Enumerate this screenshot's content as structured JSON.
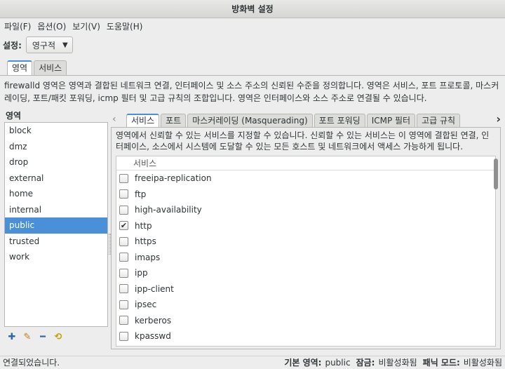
{
  "window": {
    "title": "방화벽 설정"
  },
  "menu": [
    "파일(F)",
    "옵션(O)",
    "보기(V)",
    "도움말(H)"
  ],
  "configuration": {
    "label": "설정:",
    "value": "영구적"
  },
  "top_tabs": [
    "영역",
    "서비스"
  ],
  "zone_description": "firewalld 영역은 영역과 결합된 네트워크 연결, 인터페이스 및 소스 주소의 신뢰된 수준을 정의합니다. 영역은 서비스, 포트 프로토콜, 마스커레이딩, 포트/패킷 포워딩, icmp 필터 및 고급 규칙의 조합입니다. 영역은 인터페이스와 소스 주소로 연결될 수 있습니다.",
  "zones": {
    "header": "영역",
    "items": [
      "block",
      "dmz",
      "drop",
      "external",
      "home",
      "internal",
      "public",
      "trusted",
      "work"
    ],
    "selected": "public"
  },
  "zone_tabs": [
    "서비스",
    "포트",
    "마스커레이딩 (Masquerading)",
    "포트 포워딩",
    "ICMP 필터",
    "고급 규칙"
  ],
  "services": {
    "description": "영역에서 신뢰할 수 있는 서비스를 지정할 수 있습니다. 신뢰할 수 있는 서비스는 이 영역에 결합된 연결, 인터페이스, 소스에서 시스템에 도달할 수 있는 모든 호스트 및 네트워크에서 액세스 가능하게 됩니다.",
    "column_header": "서비스",
    "items": [
      {
        "name": "freeipa-replication",
        "checked": false
      },
      {
        "name": "ftp",
        "checked": false
      },
      {
        "name": "high-availability",
        "checked": false
      },
      {
        "name": "http",
        "checked": true
      },
      {
        "name": "https",
        "checked": false
      },
      {
        "name": "imaps",
        "checked": false
      },
      {
        "name": "ipp",
        "checked": false
      },
      {
        "name": "ipp-client",
        "checked": false
      },
      {
        "name": "ipsec",
        "checked": false
      },
      {
        "name": "kerberos",
        "checked": false
      },
      {
        "name": "kpasswd",
        "checked": false
      }
    ]
  },
  "icons": {
    "add": "add-icon",
    "edit": "edit-icon",
    "remove": "remove-icon",
    "load_defaults": "load-defaults-icon"
  },
  "status": {
    "message": "연결되었습니다.",
    "default_zone_label": "기본 영역:",
    "default_zone_value": "public",
    "lockdown_label": "잠금:",
    "lockdown_value": "비활성화됨",
    "panic_label": "패닉 모드:",
    "panic_value": "비활성화됨"
  }
}
